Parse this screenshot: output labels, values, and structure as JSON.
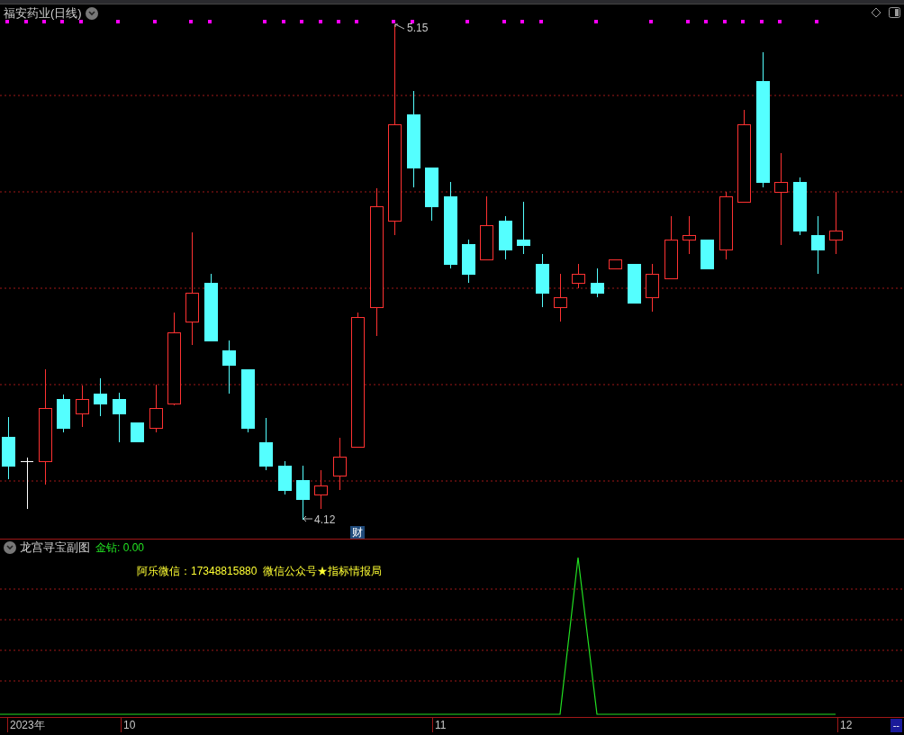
{
  "main_chart": {
    "title": "福安药业(日线)",
    "high_label": "5.15",
    "low_label": "4.12",
    "event_marker": "财"
  },
  "sub_chart": {
    "title": "龙宫寻宝副图",
    "indicator": "金钻: 0.00",
    "note": "阿乐微信：17348815880  微信公众号★指标情报局"
  },
  "time_axis": {
    "labels": [
      "2023年",
      "10",
      "11",
      "12"
    ],
    "corner": "--"
  }
}
